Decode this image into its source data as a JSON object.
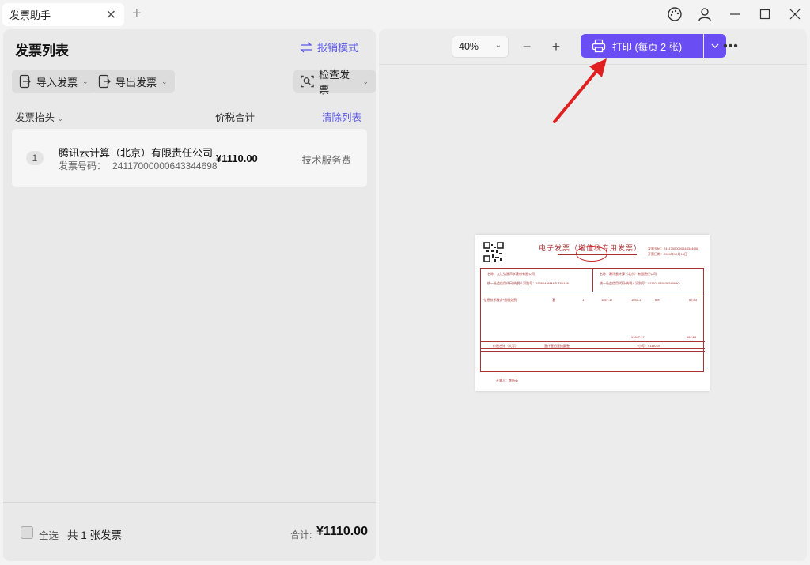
{
  "window": {
    "tab_title": "发票助手"
  },
  "left_panel": {
    "title": "发票列表",
    "mode_button": "报销模式",
    "toolbar": {
      "import_label": "导入发票",
      "export_label": "导出发票",
      "check_label": "检查发票"
    },
    "columns": {
      "header": "发票抬头",
      "amount": "价税合计",
      "clear": "清除列表"
    },
    "rows": [
      {
        "index": "1",
        "title": "腾讯云计算（北京）有限责任公司",
        "code_label": "发票号码：",
        "code": "24117000000643344698",
        "amount": "¥1110.00",
        "category": "技术服务费"
      }
    ],
    "footer": {
      "select_all": "全选",
      "count_text": "共 1 张发票",
      "sum_label": "合计:",
      "sum_value": "¥1110.00"
    }
  },
  "right_panel": {
    "zoom_value": "40%",
    "print_label": "打印 (每页 2 张)",
    "invoice": {
      "title": "电子发票（增值税专用发票）",
      "number_label": "发票号码：24117000000643344698",
      "date_label": "开票日期：2024年10月16日",
      "seller_line": "名称：九江弘源声学建材有限公司",
      "seller_tax": "统一社会信用代码/纳税人识别号：91360426MA7LT8Y446",
      "buyer_line": "名称：腾讯云计算（北京）有限责任公司",
      "buyer_tax": "统一社会信用代码/纳税人识别号：91110108563654968Q",
      "item": "*信息技术服务*云服务费",
      "item_unit": "套",
      "item_qty": "1",
      "item_price": "1047.17",
      "item_amount": "1047.17",
      "item_rate": "6%",
      "item_tax": "62.83",
      "sum_amount": "¥1047.17",
      "sum_tax": "¥62.83",
      "total_label": "价税合计（大写）",
      "total_words": "壹仟壹佰壹拾圆整",
      "total_small": "（小写）¥1110.00",
      "issuer": "开票人：李新英"
    }
  },
  "colors": {
    "accent": "#6a4df3",
    "link": "#5b57e6",
    "invoice_red": "#a33",
    "arrow_red": "#e02020"
  }
}
